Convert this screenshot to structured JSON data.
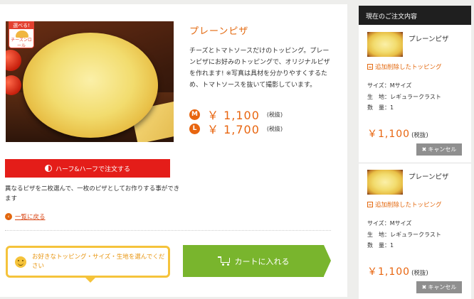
{
  "product": {
    "badge_top": "選べる!",
    "badge_bottom": "チーズンロール",
    "title": "プレーンピザ",
    "description": "チーズとトマトソースだけのトッピング。プレーンピザにお好みのトッピングで、オリジナルピザを作れます! ※写真は具材を分かりやすくするため、トマトソースを抜いて撮影しています。",
    "prices": [
      {
        "size": "M",
        "price": "￥ 1,100",
        "tax": "(税抜)"
      },
      {
        "size": "L",
        "price": "￥ 1,700",
        "tax": "(税抜)"
      }
    ]
  },
  "half_button_label": "ハーフ&ハーフで注文する",
  "half_note": "異なるピザを二枚選んで、一枚のピザとしてお作りする事ができます",
  "back_link": "一覧に戻る",
  "hint_text": "お好きなトッピング・サイズ・生地を選んでください",
  "cart_button_label": "カートに入れる",
  "sidebar": {
    "title": "現在のご注文内容",
    "items": [
      {
        "name": "プレーンピザ",
        "topping_link": "追加削除したトッピング",
        "size": "サイズ：Mサイズ",
        "crust": "生　地：レギュラークラスト",
        "qty": "数　量：1",
        "price": "￥1,100",
        "tax": "(税抜)",
        "cancel": "キャンセル"
      },
      {
        "name": "プレーンピザ",
        "topping_link": "追加削除したトッピング",
        "size": "サイズ：Mサイズ",
        "crust": "生　地：レギュラークラスト",
        "qty": "数　量：1",
        "price": "￥1,100",
        "tax": "(税抜)",
        "cancel": "キャンセル"
      }
    ]
  },
  "colors": {
    "accent_orange": "#e8650f",
    "half_red": "#e41d19",
    "cart_green": "#79b52d",
    "hint_yellow": "#f5c33b"
  }
}
